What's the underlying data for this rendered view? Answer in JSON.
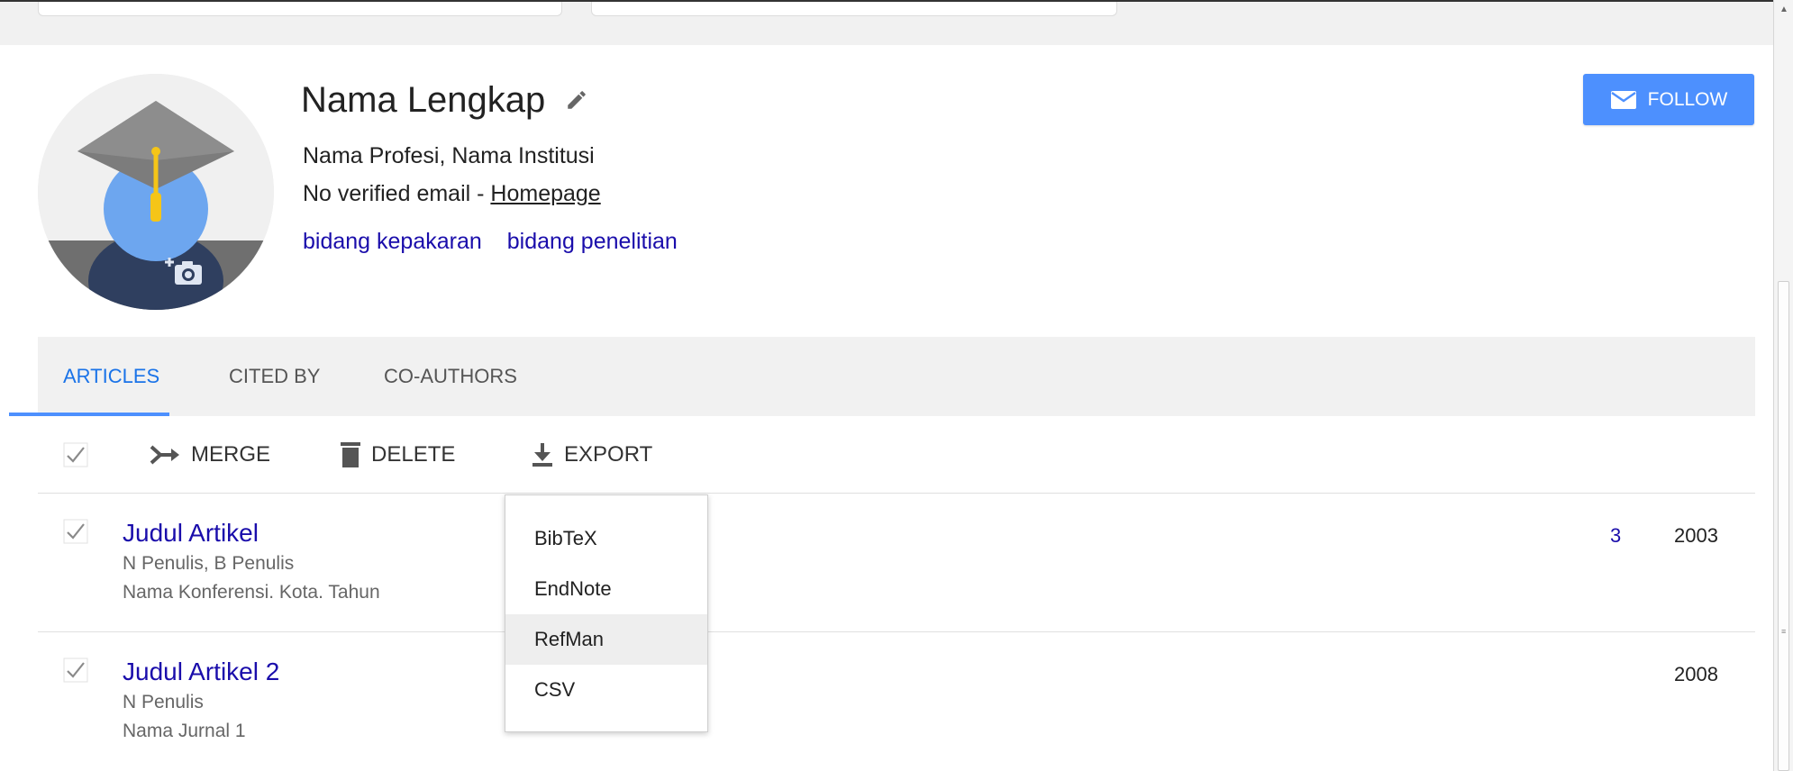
{
  "profile": {
    "name": "Nama Lengkap",
    "affiliation": "Nama Profesi, Nama Institusi",
    "email_text": "No verified email - ",
    "homepage_link": "Homepage",
    "interests": [
      "bidang kepakaran",
      "bidang penelitian"
    ]
  },
  "follow": {
    "label": "FOLLOW"
  },
  "tabs": [
    {
      "label": "ARTICLES",
      "active": true
    },
    {
      "label": "CITED BY",
      "active": false
    },
    {
      "label": "CO-AUTHORS",
      "active": false
    }
  ],
  "toolbar": {
    "merge_label": "MERGE",
    "delete_label": "DELETE",
    "export_label": "EXPORT"
  },
  "articles": [
    {
      "title": "Judul Artikel",
      "authors": "N Penulis, B Penulis",
      "venue": "Nama Konferensi. Kota. Tahun",
      "cited_by": "3",
      "year": "2003",
      "checked": true
    },
    {
      "title": "Judul Artikel 2",
      "authors": "N Penulis",
      "venue": "Nama Jurnal 1",
      "cited_by": "",
      "year": "2008",
      "checked": true
    }
  ],
  "export_menu": {
    "items": [
      "BibTeX",
      "EndNote",
      "RefMan",
      "CSV"
    ],
    "highlighted": "RefMan"
  },
  "colors": {
    "accent": "#4d90fe",
    "link": "#1a0dab",
    "tab_active": "#1a73e8",
    "tab_bar_bg": "#f1f1f1"
  }
}
